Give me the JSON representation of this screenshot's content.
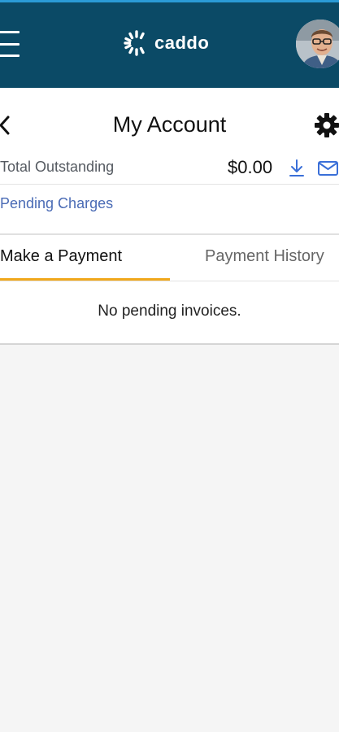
{
  "header": {
    "brand": "caddo",
    "colors": {
      "bar": "#0b4a66",
      "accent": "#2b9bd6"
    },
    "icons": {
      "menu": "hamburger-icon",
      "avatar": "user-avatar"
    }
  },
  "page": {
    "title": "My Account",
    "icons": {
      "back": "back-chevron-icon",
      "settings": "gear-icon"
    }
  },
  "account": {
    "total_label": "Total Outstanding",
    "total_amount": "$0.00",
    "icons": {
      "download": "download-icon",
      "email": "mail-icon"
    },
    "pending_link": "Pending Charges"
  },
  "tabs": [
    {
      "label": "Make a Payment",
      "active": true
    },
    {
      "label": "Payment History",
      "active": false
    }
  ],
  "content": {
    "empty_message": "No pending invoices."
  },
  "colors": {
    "link": "#4a6bb5",
    "tab_indicator": "#f0a81c"
  }
}
